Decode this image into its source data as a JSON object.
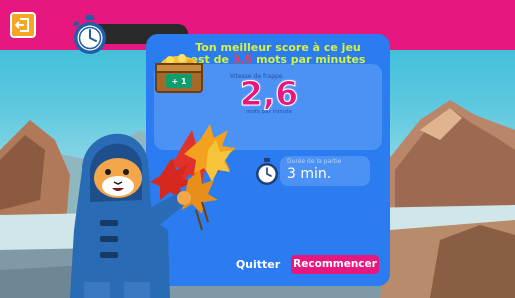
{
  "best_score": {
    "line1": "Ton meilleur score à ce jeu",
    "line2_prefix": "est de ",
    "value": "3,5",
    "line2_suffix": " mots par minutes"
  },
  "speed": {
    "label": "Vitesse de frappe",
    "value": "2,6",
    "unit": "mots par minute"
  },
  "reward_badge": "+ 1",
  "duration": {
    "label": "Durée de la partie",
    "value": "3 min."
  },
  "buttons": {
    "quit": "Quitter",
    "restart": "Recommencer"
  },
  "colors": {
    "topbar": "#e6177f",
    "panel": "#2a7cf0",
    "accent_pink": "#e6177f",
    "best_text": "#d8f23b",
    "best_value": "#ff3b3b",
    "exit_button": "#f5a623"
  }
}
